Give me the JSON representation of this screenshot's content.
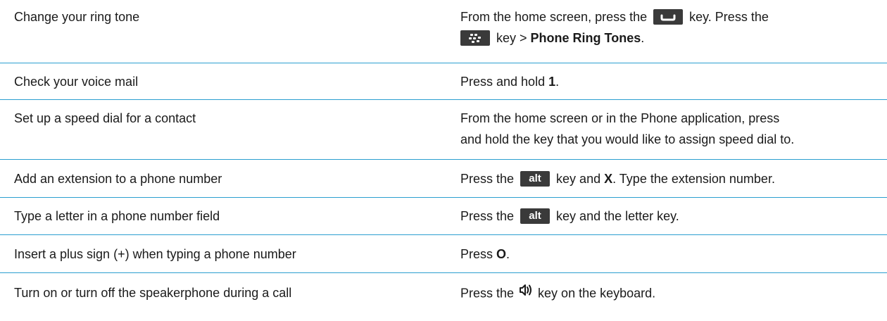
{
  "rows": [
    {
      "task": "Change your ring tone",
      "instruction": {
        "part1": "From the home screen, press the",
        "send_key_icon": "send-key-icon",
        "part2": "key. Press the",
        "menu_key_icon": "blackberry-menu-key-icon",
        "part3": "key >",
        "bold": "Phone Ring Tones",
        "part4": "."
      }
    },
    {
      "task": "Check your voice mail",
      "instruction": {
        "part1": "Press and hold",
        "bold": "1",
        "part2": "."
      }
    },
    {
      "task": "Set up a speed dial for a contact",
      "instruction": {
        "line1": "From the home screen or in the Phone application, press",
        "line2": "and hold the key that you would like to assign speed dial to."
      }
    },
    {
      "task": "Add an extension to a phone number",
      "instruction": {
        "part1": "Press the",
        "key_label": "alt",
        "part2": "key and",
        "bold": "X",
        "part3": ". Type the extension number."
      }
    },
    {
      "task": "Type a letter in a phone number field",
      "instruction": {
        "part1": "Press the",
        "key_label": "alt",
        "part2": "key and the letter key."
      }
    },
    {
      "task": "Insert a plus sign (+) when typing a phone number",
      "instruction": {
        "part1": "Press",
        "bold": "O",
        "part2": "."
      }
    },
    {
      "task": "Turn on or turn off the speakerphone during a call",
      "instruction": {
        "part1": "Press the",
        "speaker_key_icon": "speakerphone-key-icon",
        "part2": "key on the keyboard."
      }
    }
  ],
  "colors": {
    "row_divider": "#2b9fd0",
    "key_background": "#3a3a3a",
    "text": "#1a1a1a"
  }
}
